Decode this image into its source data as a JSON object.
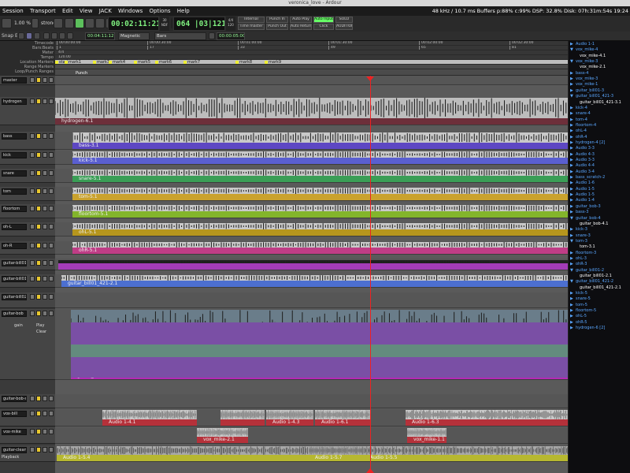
{
  "window": {
    "title": "veronica_love - Ardour"
  },
  "menu": [
    "Session",
    "Transport",
    "Edit",
    "View",
    "JACK",
    "Windows",
    "Options",
    "Help"
  ],
  "status": {
    "text": "48 kHz / 10.7 ms  Buffers p:88% c:99%  DSP:  32.8%  Disk: 07h:31m:54s  19:24"
  },
  "toolbar": {
    "zoom": "1.00 %",
    "mode": "strong",
    "clock_primary": "00:02:11:21",
    "clock_primary_sub": [
      "30",
      "NDF"
    ],
    "clock_secondary": "064 |03|1213",
    "clock_secondary_sub": [
      "4/4",
      "120"
    ],
    "buttons": {
      "internal": "Internal",
      "time_master": "Time master",
      "punch_in": "Punch In",
      "punch_out": "Punch Out",
      "auto_play": "Auto Play",
      "auto_return": "Auto Return",
      "auto_input": "Auto Input",
      "click": "Click",
      "solo": "SOLO",
      "audition": "AUDITION"
    }
  },
  "toolbar2": {
    "snap": "Snap Edit",
    "nudge_clock": "00:04:11:12",
    "snap_type": "Magnetic",
    "grid": "Bars",
    "nudge_clock2": "00:00:05:00"
  },
  "rulers": {
    "labels": [
      "Timecode",
      "Bars:Beats",
      "Meter",
      "Tempo",
      "Location Markers",
      "Range Markers",
      "Loop/Punch Ranges"
    ],
    "timecode": [
      "00:00:00:00",
      "00:00:30:00",
      "00:01:00:00",
      "00:01:30:00",
      "00:02:00:00",
      "00:02:30:00"
    ],
    "bars": [
      "1",
      "17",
      "33",
      "49",
      "65",
      "81"
    ],
    "meter": "4/4",
    "tempo": "120.00",
    "markers": [
      "start",
      "mark1",
      "mark3",
      "mark4",
      "mark5",
      "mark6",
      "mark7",
      "mark8",
      "mark9"
    ],
    "punch_label": "Punch"
  },
  "tracks": [
    {
      "name": "master",
      "color": "#3c3c3c"
    },
    {
      "name": "hydrogen",
      "region": "hydrogen-6.1",
      "color": "#6d2f3a"
    },
    {
      "name": "bass",
      "region": "bass-3.1",
      "color": "#5d47c3"
    },
    {
      "name": "kick",
      "region": "kick-5.1",
      "color": "#5a5fd0"
    },
    {
      "name": "snare",
      "region": "snare-5.1",
      "color": "#3a9e56"
    },
    {
      "name": "tom",
      "region": "tom-5.1",
      "color": "#caa22d"
    },
    {
      "name": "floortom",
      "region": "floortom-5.1",
      "color": "#83b52b"
    },
    {
      "name": "oh-L",
      "region": "ohL-5.1",
      "color": "#b6961d"
    },
    {
      "name": "oh-R",
      "region": "ohR-5.1",
      "color": "#bf3d86"
    },
    {
      "name": "guitar-bill01",
      "region": "",
      "color": "#a43cb8"
    },
    {
      "name": "guitar-bill01-4",
      "region": "guitar_bill01_421-2.1",
      "color": "#4c6fd0"
    },
    {
      "name": "guitar-bill02-4",
      "region": "",
      "color": "#555"
    },
    {
      "name": "guitar-bob",
      "region": "guitar_bob-4.1",
      "color": "#b42ab4",
      "buttons": [
        "gain",
        "Play",
        "Clear"
      ]
    },
    {
      "name": "guitar-bob-sm",
      "region": "",
      "color": "#555"
    },
    {
      "name": "vox-bill",
      "regions": [
        "Audio 1-4.1",
        "Audio 1-4.3",
        "Audio 1-6.1",
        "Audio 1-6.3"
      ],
      "color": "#b5313a"
    },
    {
      "name": "vox-mike",
      "regions": [
        "vox_mike-2.1",
        "vox_mike-1.1"
      ],
      "color": "#b5313a"
    },
    {
      "name": "guitar-clean",
      "regions": [
        "Audio 1-5.4",
        "Audio 1-5.7",
        "Audio 1-5.5"
      ],
      "color": "#b7b830",
      "extra": "Playback"
    }
  ],
  "regionlist": [
    {
      "t": "Audio 1-1",
      "c": "blue",
      "a": "▶"
    },
    {
      "t": "vox_mike-4",
      "c": "blue",
      "a": "▼"
    },
    {
      "t": "vox_mike-4.1",
      "c": "white",
      "a": ""
    },
    {
      "t": "vox_mike-3",
      "c": "blue",
      "a": "▼"
    },
    {
      "t": "vox_mike-2.1",
      "c": "white",
      "a": ""
    },
    {
      "t": "bass-4",
      "c": "blue",
      "a": "▶"
    },
    {
      "t": "vox_mike-3",
      "c": "blue",
      "a": "▶"
    },
    {
      "t": "vox_mike-1",
      "c": "blue",
      "a": "▶"
    },
    {
      "t": "guitar_bill01-3",
      "c": "blue",
      "a": "▶"
    },
    {
      "t": "guitar_bill01_421-3",
      "c": "blue",
      "a": "▼"
    },
    {
      "t": "guitar_bill01_421-3.1",
      "c": "white",
      "a": ""
    },
    {
      "t": "kick-4",
      "c": "blue",
      "a": "▶"
    },
    {
      "t": "snare-4",
      "c": "blue",
      "a": "▶"
    },
    {
      "t": "tom-4",
      "c": "blue",
      "a": "▶"
    },
    {
      "t": "floortom-4",
      "c": "blue",
      "a": "▶"
    },
    {
      "t": "ohL-4",
      "c": "blue",
      "a": "▶"
    },
    {
      "t": "ohR-4",
      "c": "blue",
      "a": "▶"
    },
    {
      "t": "hydrogen-4 [2]",
      "c": "blue",
      "a": "▶"
    },
    {
      "t": "Audio 3-3",
      "c": "blue",
      "a": "▶"
    },
    {
      "t": "Audio 4-3",
      "c": "blue",
      "a": "▶"
    },
    {
      "t": "Audio 3-3",
      "c": "blue",
      "a": "▶"
    },
    {
      "t": "Audio 4-4",
      "c": "blue",
      "a": "▶"
    },
    {
      "t": "Audio 3-4",
      "c": "blue",
      "a": "▶"
    },
    {
      "t": "bass_scratch-2",
      "c": "blue",
      "a": "▶"
    },
    {
      "t": "Audio 1-6",
      "c": "blue",
      "a": "▶"
    },
    {
      "t": "Audio 1-5",
      "c": "blue",
      "a": "▶"
    },
    {
      "t": "Audio 1-5",
      "c": "blue",
      "a": "▶"
    },
    {
      "t": "Audio 1-4",
      "c": "blue",
      "a": "▶"
    },
    {
      "t": "guitar_bob-3",
      "c": "blue",
      "a": "▶"
    },
    {
      "t": "bass-3",
      "c": "blue",
      "a": "▶"
    },
    {
      "t": "guitar_bob-4",
      "c": "blue",
      "a": "▼"
    },
    {
      "t": "guitar_bob-4.1",
      "c": "white",
      "a": ""
    },
    {
      "t": "kick-3",
      "c": "blue",
      "a": "▶"
    },
    {
      "t": "snare-3",
      "c": "blue",
      "a": "▶"
    },
    {
      "t": "tom-3",
      "c": "blue",
      "a": "▼"
    },
    {
      "t": "tom-3.1",
      "c": "white",
      "a": ""
    },
    {
      "t": "floortom-3",
      "c": "blue",
      "a": "▶"
    },
    {
      "t": "ohL-3",
      "c": "blue",
      "a": "▶"
    },
    {
      "t": "ohR-3",
      "c": "blue",
      "a": "▶"
    },
    {
      "t": "guitar_bill01-2",
      "c": "blue",
      "a": "▼"
    },
    {
      "t": "guitar_bill01-2.1",
      "c": "white",
      "a": ""
    },
    {
      "t": "guitar_bill01_421-2",
      "c": "blue",
      "a": "▼"
    },
    {
      "t": "guitar_bill01_421-2.1",
      "c": "white",
      "a": ""
    },
    {
      "t": "kick-5",
      "c": "blue",
      "a": "▶"
    },
    {
      "t": "snare-5",
      "c": "blue",
      "a": "▶"
    },
    {
      "t": "tom-5",
      "c": "blue",
      "a": "▶"
    },
    {
      "t": "floortom-5",
      "c": "blue",
      "a": "▶"
    },
    {
      "t": "ohL-5",
      "c": "blue",
      "a": "▶"
    },
    {
      "t": "ohR-5",
      "c": "blue",
      "a": "▶"
    },
    {
      "t": "hydrogen-6 [2]",
      "c": "blue",
      "a": "▶"
    }
  ]
}
